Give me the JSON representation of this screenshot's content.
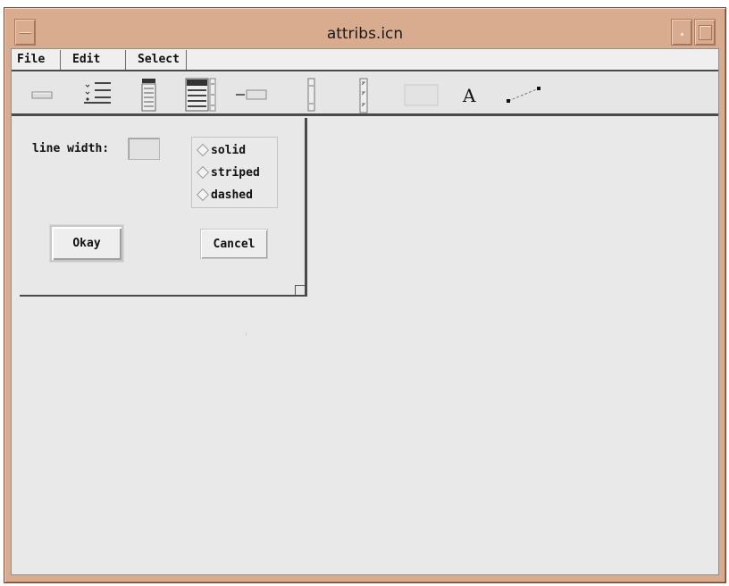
{
  "window": {
    "title": "attribs.icn"
  },
  "menubar": {
    "items": [
      "File",
      "Edit",
      "Select"
    ]
  },
  "toolbar": {
    "tools": [
      {
        "name": "button-tool-icon"
      },
      {
        "name": "radio-buttons-tool-icon"
      },
      {
        "name": "menu-tool-icon"
      },
      {
        "name": "list-tool-icon"
      },
      {
        "name": "text-input-tool-icon"
      },
      {
        "name": "vertical-scrollbar-tool-icon"
      },
      {
        "name": "slider-tool-icon"
      },
      {
        "name": "region-tool-icon"
      },
      {
        "name": "label-tool-icon"
      },
      {
        "name": "line-tool-icon"
      }
    ],
    "label_glyph": "A"
  },
  "dialog": {
    "line_width_label": "line width:",
    "line_width_value": "",
    "line_styles": [
      "solid",
      "striped",
      "dashed"
    ],
    "okay_label": "Okay",
    "cancel_label": "Cancel"
  },
  "colors": {
    "frame": "#d9ab8f",
    "client_background": "#e9e9e9",
    "separator": "#4a4a4a"
  }
}
